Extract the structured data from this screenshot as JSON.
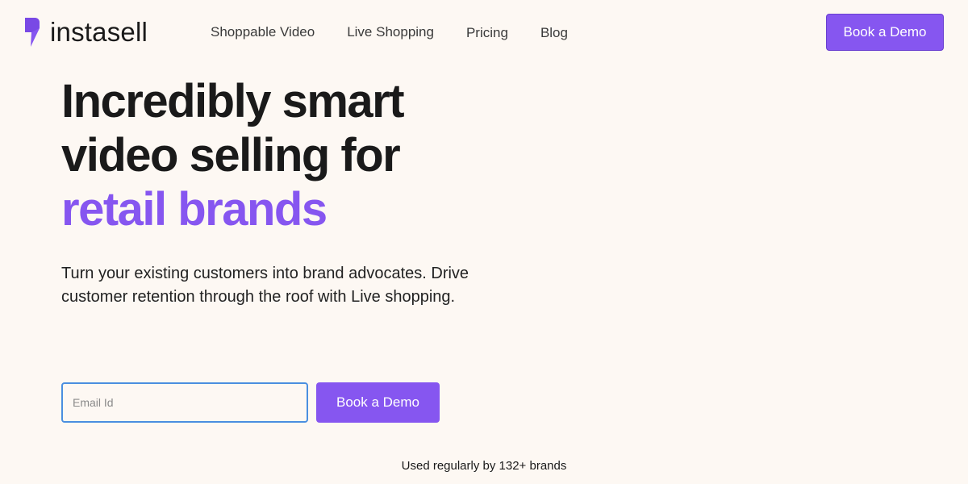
{
  "brand": {
    "name": "instasell",
    "logo_icon": "lightning-bolt-icon",
    "accent_color": "#8656f0"
  },
  "nav": {
    "items": [
      {
        "label": "Shoppable Video"
      },
      {
        "label": "Live Shopping"
      },
      {
        "label": "Pricing"
      },
      {
        "label": "Blog"
      }
    ],
    "cta_label": "Book a Demo"
  },
  "hero": {
    "title_line1": "Incredibly smart",
    "title_line2": "video selling for",
    "title_accent": "retail brands",
    "subtitle": "Turn your existing customers into brand advocates. Drive customer retention through the roof with Live shopping.",
    "email_placeholder": "Email Id",
    "cta_label": "Book a Demo"
  },
  "social_proof": {
    "text": "Used regularly by 132+ brands"
  }
}
